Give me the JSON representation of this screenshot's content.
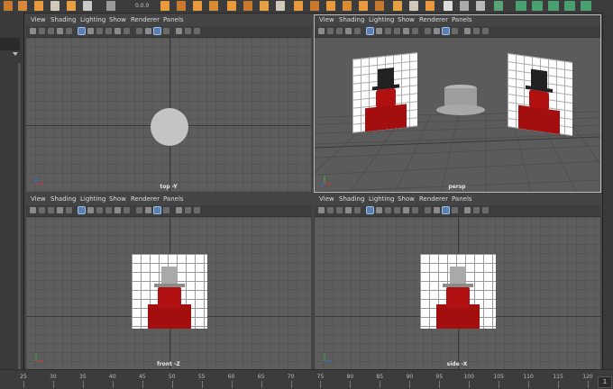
{
  "shelf": {
    "icons": [
      "sphere-icon",
      "cube-icon",
      "cylinder-icon",
      "cone-icon",
      "plane-icon",
      "torus-icon",
      "subdiv-icon",
      "lattice-icon",
      "light-icon",
      "camera-icon",
      "move-tool-icon",
      "rotate-tool-icon",
      "scale-tool-icon",
      "render-icon",
      "ipr-icon",
      "hypershade-icon"
    ],
    "readout": "0.0.0"
  },
  "menu": [
    "View",
    "Shading",
    "Lighting",
    "Show",
    "Renderer",
    "Panels"
  ],
  "viewports": [
    {
      "id": "top",
      "camera_label": "top -Y"
    },
    {
      "id": "persp",
      "camera_label": "persp"
    },
    {
      "id": "front",
      "camera_label": "front -Z"
    },
    {
      "id": "side",
      "camera_label": "side -X"
    }
  ],
  "timeline": {
    "ticks": [
      "25",
      "30",
      "35",
      "40",
      "45",
      "50",
      "55",
      "60",
      "65",
      "70",
      "75",
      "80",
      "85",
      "90",
      "95",
      "100",
      "105",
      "110",
      "115",
      "120"
    ],
    "current_frame": "1"
  },
  "colors": {
    "accent": "#e89a3c",
    "viewport_bg": "#5d5d5d",
    "grid": "#545454",
    "figure_red": "#b01010",
    "hat": "#a9a9a9"
  }
}
